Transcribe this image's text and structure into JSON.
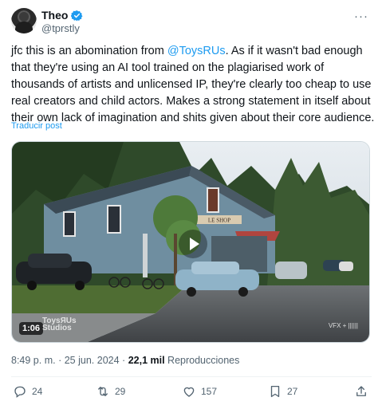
{
  "author": {
    "display_name": "Theo",
    "handle": "@tprstly",
    "verified_icon": "verified-badge-icon",
    "avatar_icon": "avatar"
  },
  "more_icon": "more-dots-icon",
  "tweet": {
    "text_before": "jfc this is an abomination from ",
    "mention": "@ToysRUs",
    "text_after": ". As if it wasn't bad enough that they're using an AI tool trained on the plagiarised work of thousands of artists and unlicensed IP, they're clearly too cheap to use real creators and child actors. Makes a strong statement in itself about their own lack of imagination and shits given about their core audience.",
    "translate_label": "Traducir post"
  },
  "media": {
    "sign_text": "LE SHOP",
    "duration": "1:06",
    "watermark_left": "ToysЯUs\nStudios",
    "watermark_right": "VFX + ||||||"
  },
  "meta": {
    "time": "8:49 p. m.",
    "separator": "·",
    "date": "25 jun. 2024",
    "views": "22,1 mil",
    "views_label": "Reproducciones"
  },
  "actions": {
    "replies": "24",
    "reposts": "29",
    "likes": "157",
    "bookmarks": "27"
  },
  "colors": {
    "accent": "#1d9bf0",
    "text": "#0f1419",
    "secondary": "#536471"
  }
}
